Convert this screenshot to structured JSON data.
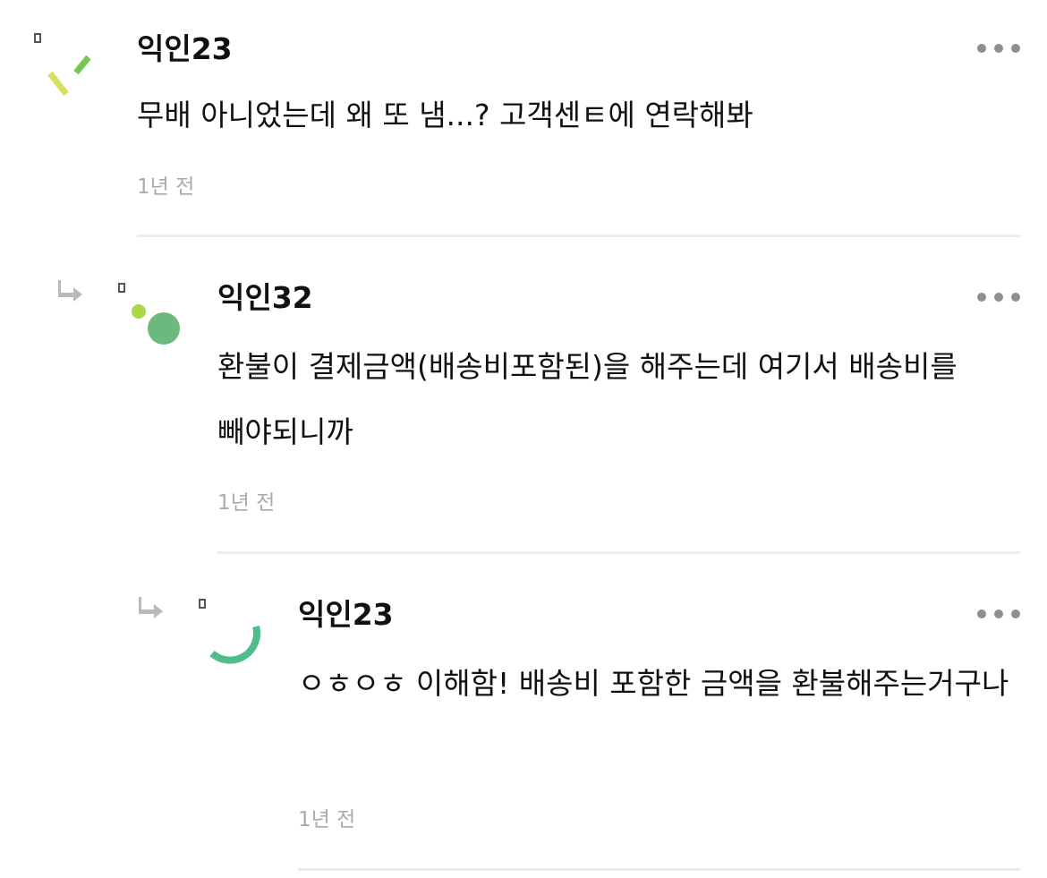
{
  "comments": [
    {
      "author": "익인23",
      "body": "무배 아니었는데 왜 또 냄...? 고객센ㅌ에 연락해봐",
      "time": "1년 전",
      "more_icon": "more-dots-icon",
      "avatar_colors": [
        "#d7df5d",
        "#77c653",
        "#555555"
      ]
    },
    {
      "author": "익인32",
      "body": "환불이 결제금액(배송비포함된)을 해주는데 여기서 배송비를 빼야되니까",
      "time": "1년 전",
      "more_icon": "more-dots-icon",
      "reply_icon": "reply-arrow-icon",
      "avatar_colors": [
        "#a8d94a",
        "#6cb87d",
        "#555555"
      ]
    },
    {
      "author": "익인23",
      "body": "ㅇㅎㅇㅎ 이해함! 배송비 포함한 금액을 환불해주는거구나",
      "time": "1년 전",
      "more_icon": "more-dots-icon",
      "reply_icon": "reply-arrow-icon",
      "avatar_colors": [
        "#4fbd8b",
        "#555555"
      ]
    }
  ],
  "colors": {
    "text": "#111111",
    "timestamp": "#aaaaaa",
    "divider": "#ececec",
    "more_dots": "#8f8f8f",
    "reply_arrow": "#b9b9b9"
  }
}
